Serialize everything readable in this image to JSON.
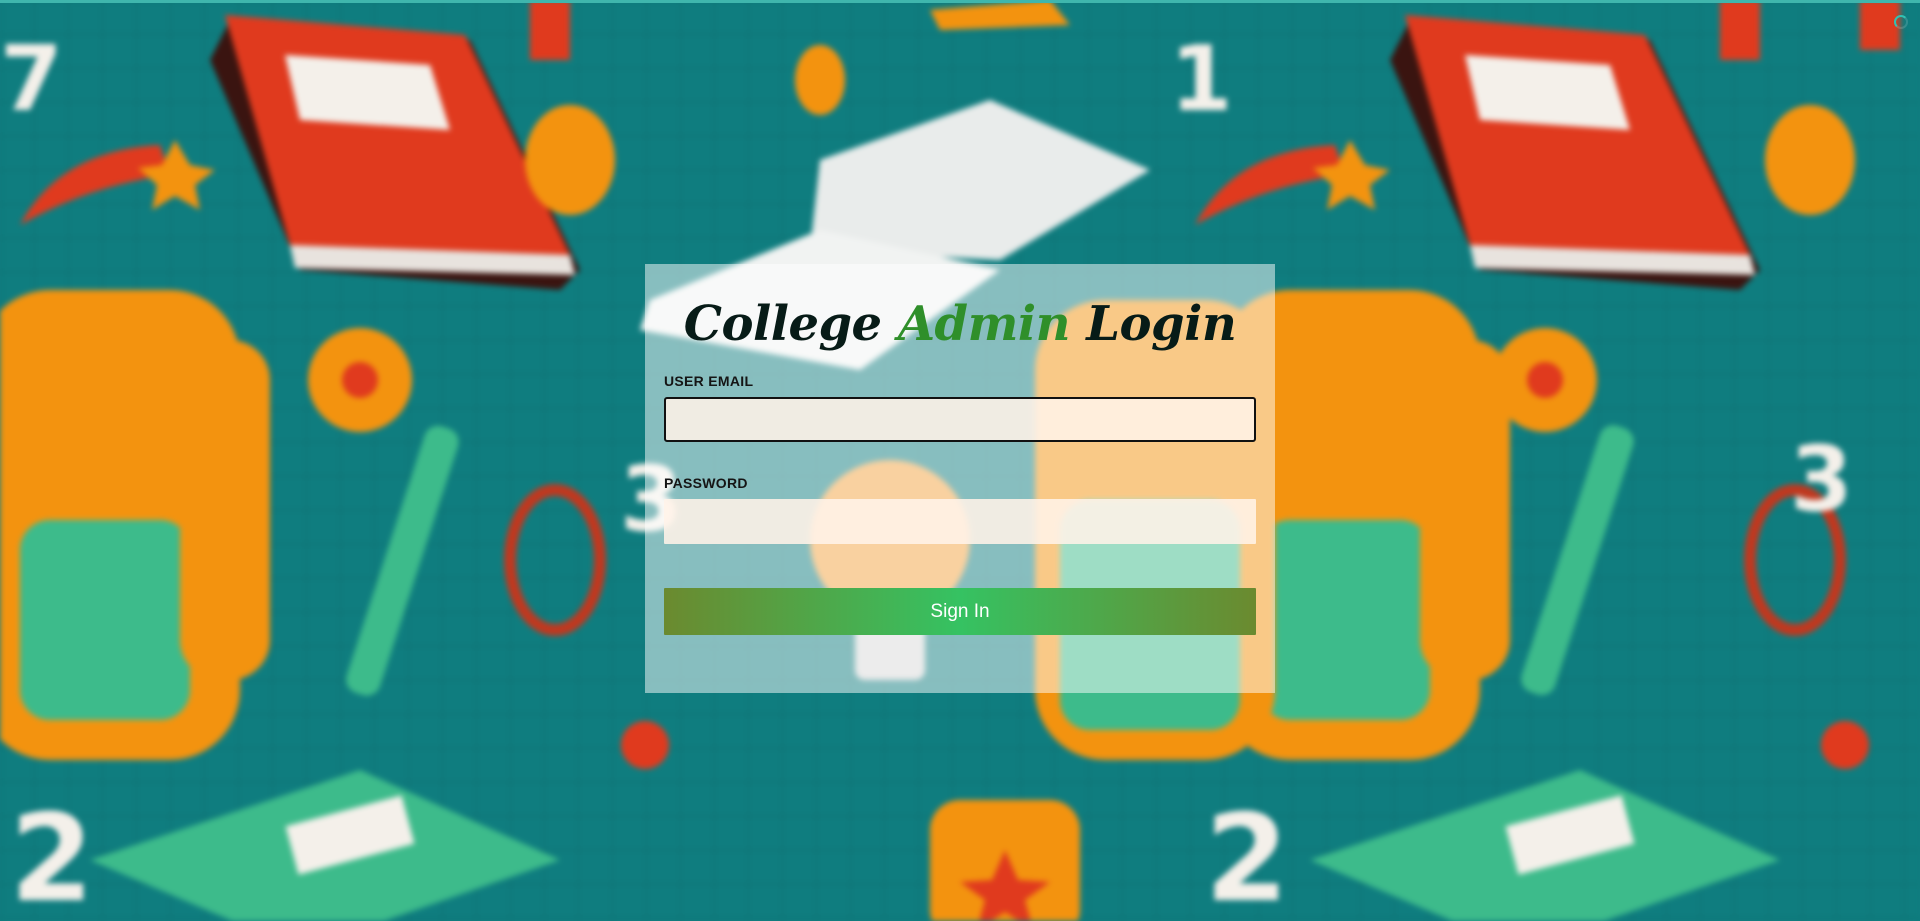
{
  "login": {
    "title_part1": "College",
    "title_part2": "Admin",
    "title_part3": "Login",
    "email_label": "USER EMAIL",
    "email_value": "",
    "password_label": "PASSWORD",
    "password_value": "",
    "submit_label": "Sign In"
  },
  "colors": {
    "background_teal": "#0f7d7f",
    "title_dark": "#071b17",
    "title_accent": "#2f8f2a",
    "button_green": "#35c262",
    "button_olive": "#6b8a2f"
  },
  "icons": {
    "loading": "loading-spinner-icon"
  }
}
